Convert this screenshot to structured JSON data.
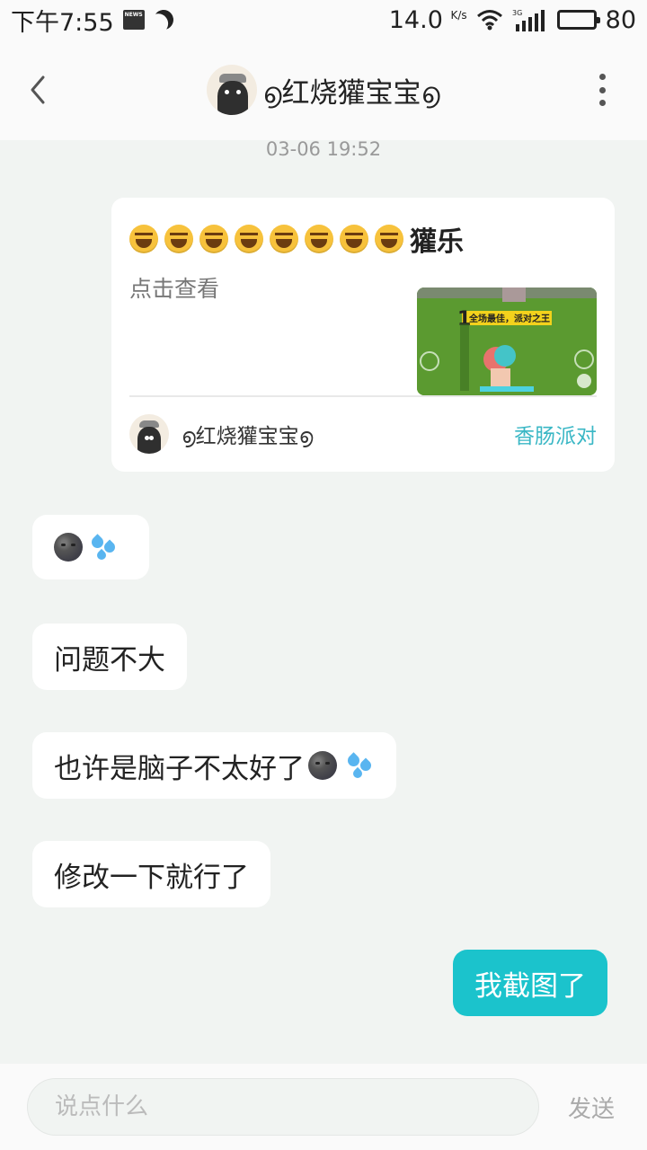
{
  "status_bar": {
    "time": "下午7:55",
    "news_badge": "NEWS",
    "network_speed": "14.0",
    "network_speed_unit": "K/s",
    "signal_type": "3G",
    "battery": "80"
  },
  "header": {
    "title": "൭红烧獾宝宝൭"
  },
  "timestamp": "03-06 19:52",
  "share_card": {
    "title_text": "獾乐",
    "laugh_emoji_count": 8,
    "subtitle": "点击查看",
    "thumb_banner": "全场最佳，派对之王",
    "author_name": "൭红烧獾宝宝൭",
    "source": "香肠派对"
  },
  "messages": [
    {
      "id": "m1",
      "text": "",
      "direction": "incoming",
      "emojis": [
        "moon-face",
        "sweat-droplets"
      ]
    },
    {
      "id": "m2",
      "text": "问题不大",
      "direction": "incoming"
    },
    {
      "id": "m3",
      "text": "也许是脑子不太好了",
      "direction": "incoming",
      "emojis": [
        "moon-face",
        "sweat-droplets"
      ]
    },
    {
      "id": "m4",
      "text": "修改一下就行了",
      "direction": "incoming"
    },
    {
      "id": "m5",
      "text": "我截图了",
      "direction": "outgoing"
    }
  ],
  "input_bar": {
    "placeholder": "说点什么",
    "send_label": "发送"
  },
  "colors": {
    "accent": "#1bc3cc",
    "background": "#f1f4f2",
    "source_link": "#3ab7c5"
  }
}
